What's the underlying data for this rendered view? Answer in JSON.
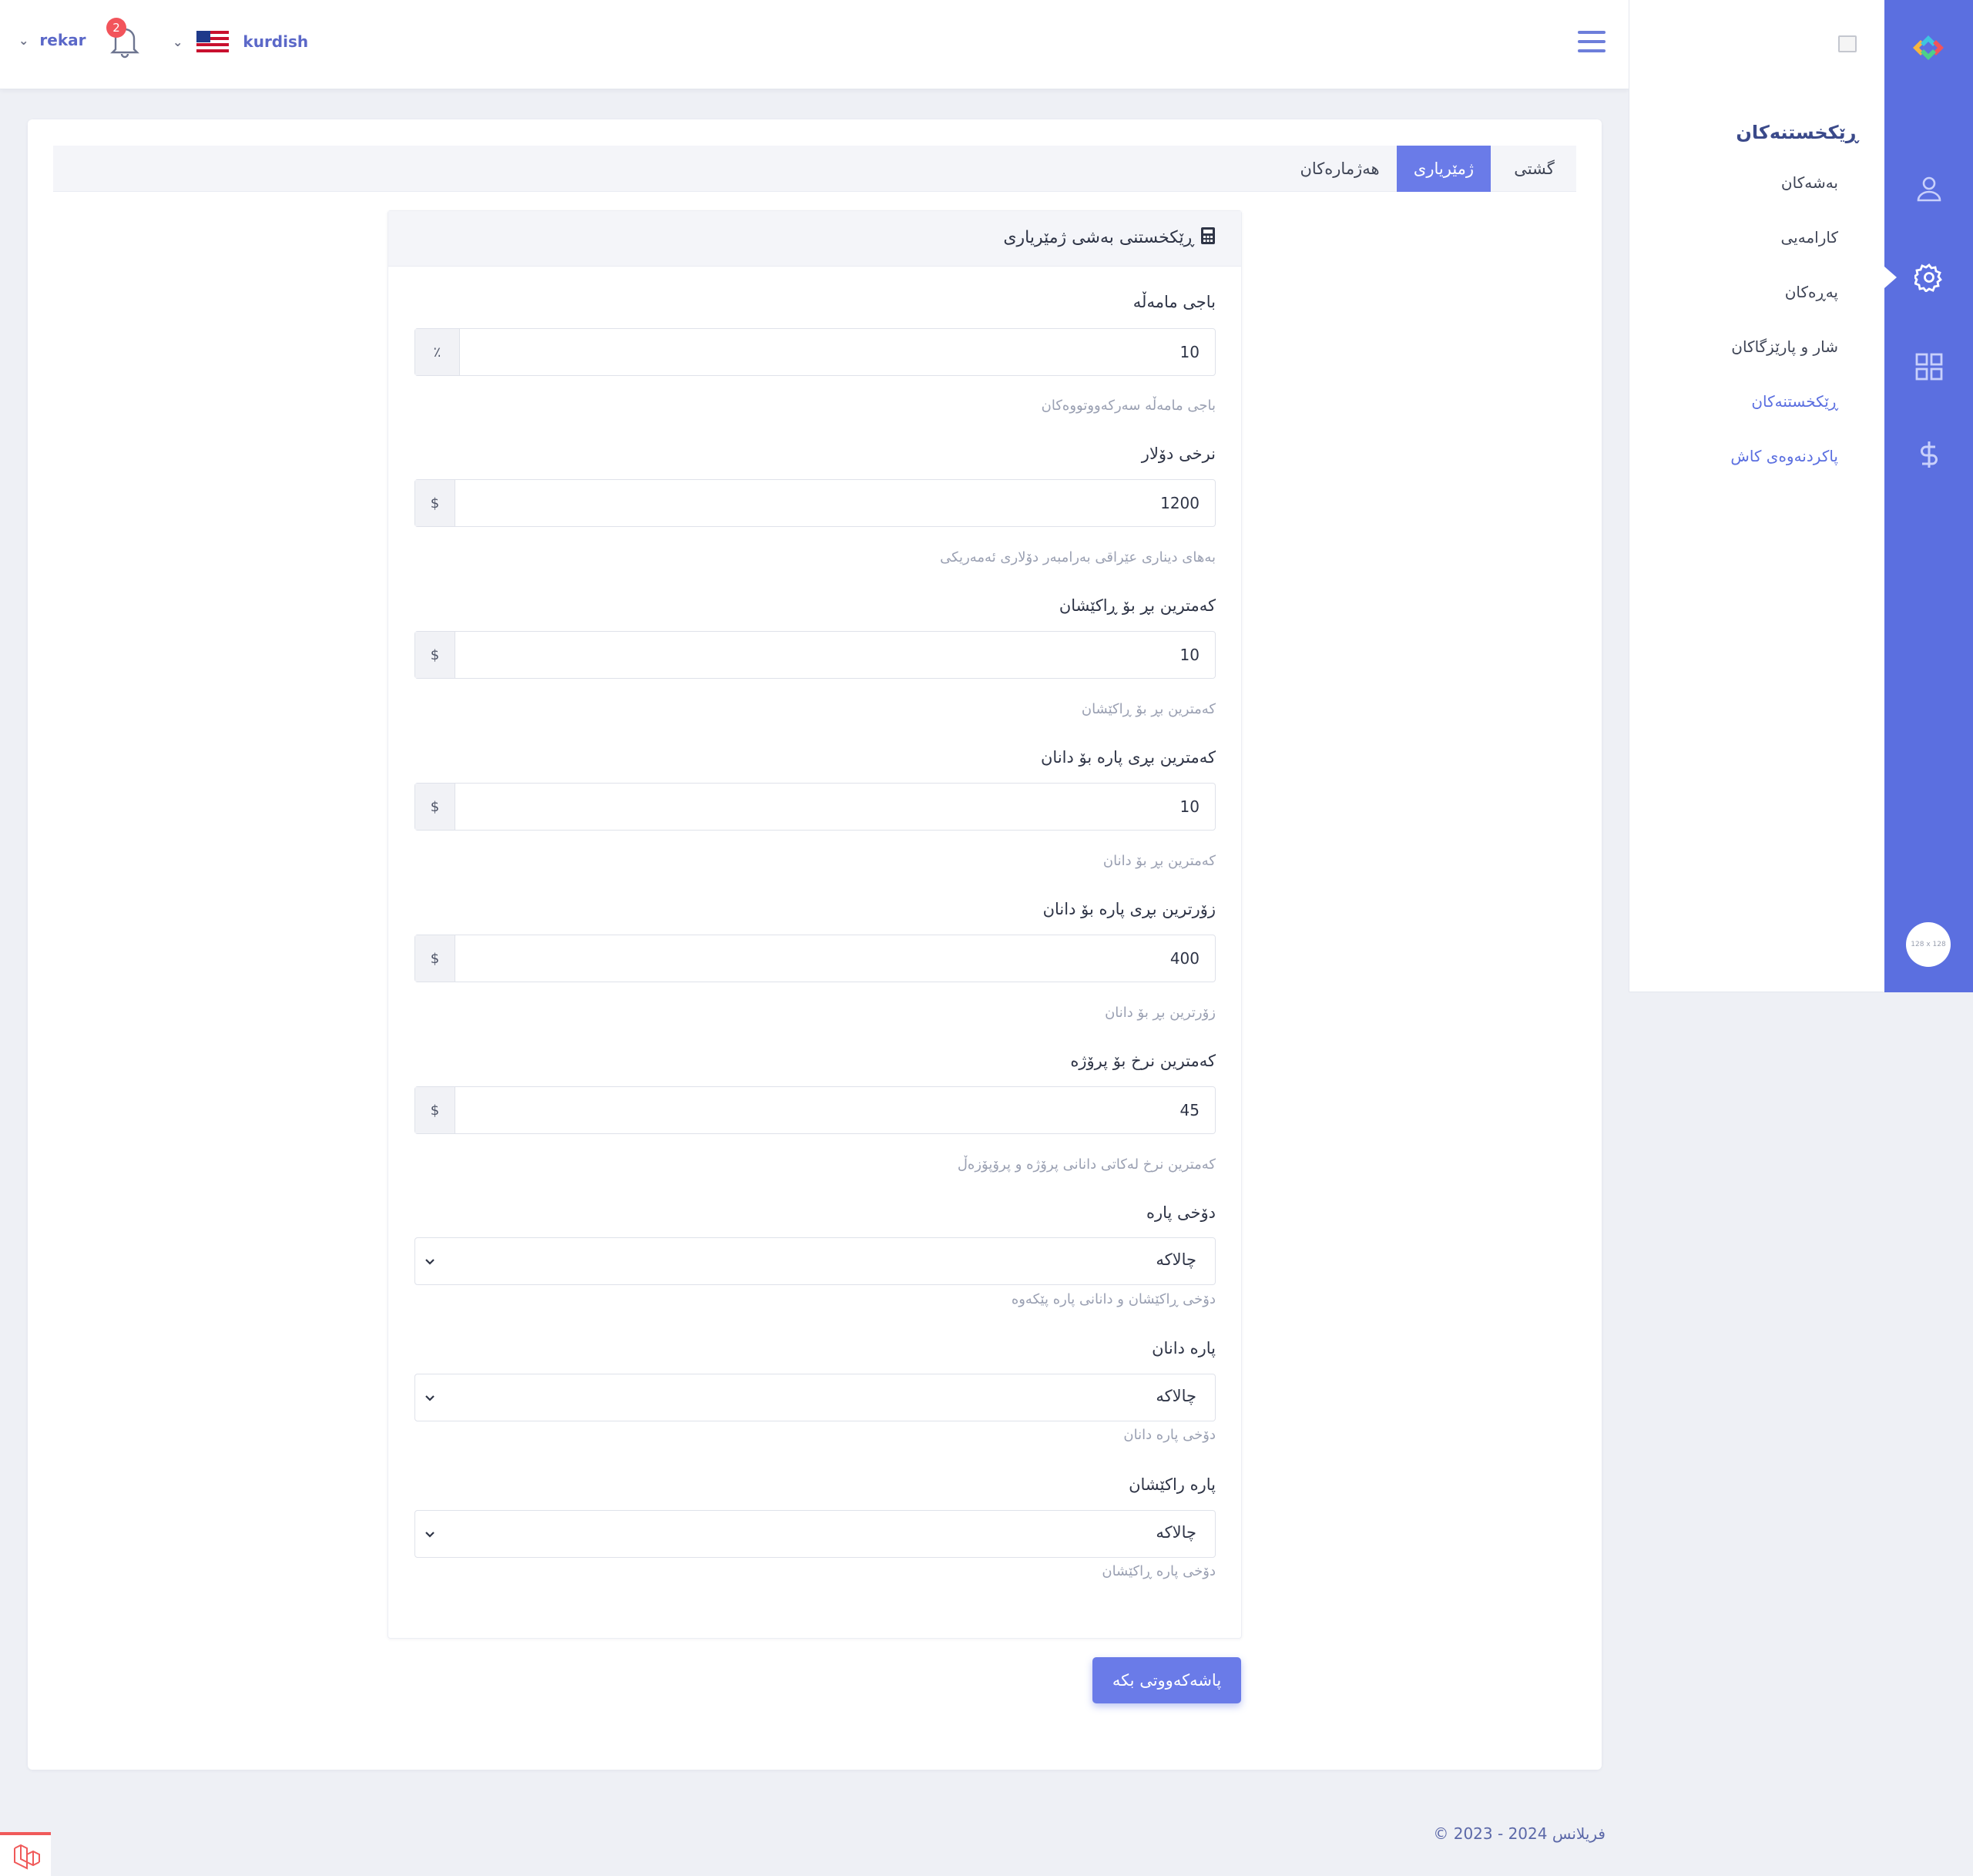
{
  "header": {
    "username": "rekar",
    "notification_count": "2",
    "language": "kurdish"
  },
  "submenu": {
    "title": "ڕێکخستنەکان",
    "items": [
      {
        "label": "بەشەکان"
      },
      {
        "label": "کارامەیی"
      },
      {
        "label": "پەڕەکان"
      },
      {
        "label": "شار و پارێزگاکان"
      },
      {
        "label": "ڕێکخستنەکان",
        "active": true
      },
      {
        "label": "پاکردنەوەی کاش"
      }
    ]
  },
  "rail": {
    "icons": [
      "user-icon",
      "gear-icon",
      "grid-icon",
      "dollar-icon"
    ],
    "avatar_placeholder": "128 x 128"
  },
  "tabs": [
    {
      "label": "گشتی"
    },
    {
      "label": "ژمێریاری",
      "active": true
    },
    {
      "label": "هەژمارەکان"
    }
  ],
  "panel": {
    "title": "ڕێکخستنی بەشی ژمێریاری",
    "fields": [
      {
        "label": "باجی مامەڵە",
        "addon": "٪",
        "value": "10",
        "help": "باجی مامەڵە سەرکەووتووەکان"
      },
      {
        "label": "نرخی دۆلار",
        "addon": "$",
        "value": "1200",
        "help": "بەهای دیناری عێراقی بەرامبەر دۆلاری ئەمەریکی"
      },
      {
        "label": "کەمترین بڕ بۆ ڕاکێشان",
        "addon": "$",
        "value": "10",
        "help": "کەمترین بڕ بۆ ڕاکێشان"
      },
      {
        "label": "کەمترین بڕی پارە بۆ دانان",
        "addon": "$",
        "value": "10",
        "help": "کەمترین بڕ بۆ دانان"
      },
      {
        "label": "زۆرترین بڕی پارە بۆ دانان",
        "addon": "$",
        "value": "400",
        "help": "زۆرترین بڕ بۆ دانان"
      },
      {
        "label": "کەمترین نرخ بۆ پرۆژە",
        "addon": "$",
        "value": "45",
        "help": "کەمترین نرخ لەکاتی دانانی پرۆژە و پرۆپۆزەڵ"
      }
    ],
    "selects": [
      {
        "label": "دۆخی پارە",
        "value": "چالاکە",
        "help": "دۆخی ڕاکێشان و دانانی پارە پێکەوە"
      },
      {
        "label": "پارە دانان",
        "value": "چالاکە",
        "help": "دۆخی پارە دانان"
      },
      {
        "label": "پارە راکێشان",
        "value": "چالاکە",
        "help": "دۆخی پارە ڕاکێشان"
      }
    ],
    "save_label": "پاشەکەووتی بکە"
  },
  "footer": {
    "text": "© 2023 - 2024 فریلانس"
  },
  "colors": {
    "accent": "#5b6fe0",
    "tab_active": "#6a7be8",
    "badge": "#f2545b"
  }
}
